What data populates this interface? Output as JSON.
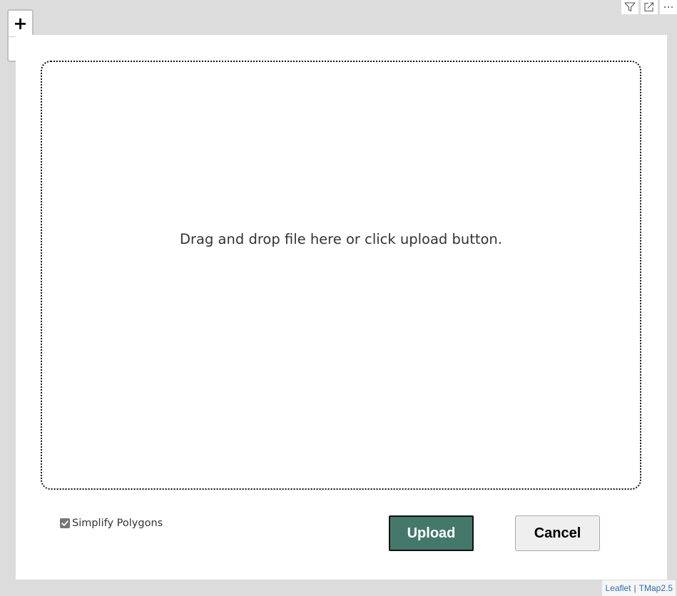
{
  "visual_header": {
    "icons": [
      "filter-icon",
      "focus-mode-icon",
      "more-options-icon"
    ]
  },
  "zoom_control": {
    "zoom_in_label": "+",
    "zoom_out_label": ""
  },
  "modal": {
    "dropzone_text": "Drag and drop file here or click upload button.",
    "simplify_label": "Simplify Polygons",
    "simplify_checked": true,
    "upload_label": "Upload",
    "cancel_label": "Cancel",
    "colors": {
      "upload_bg": "#44786a",
      "cancel_bg": "#efefef",
      "checkbox": "#767676"
    }
  },
  "attribution": {
    "leaflet_link": "Leaflet",
    "separator": "|",
    "tmap_link": "TMap2.5"
  }
}
